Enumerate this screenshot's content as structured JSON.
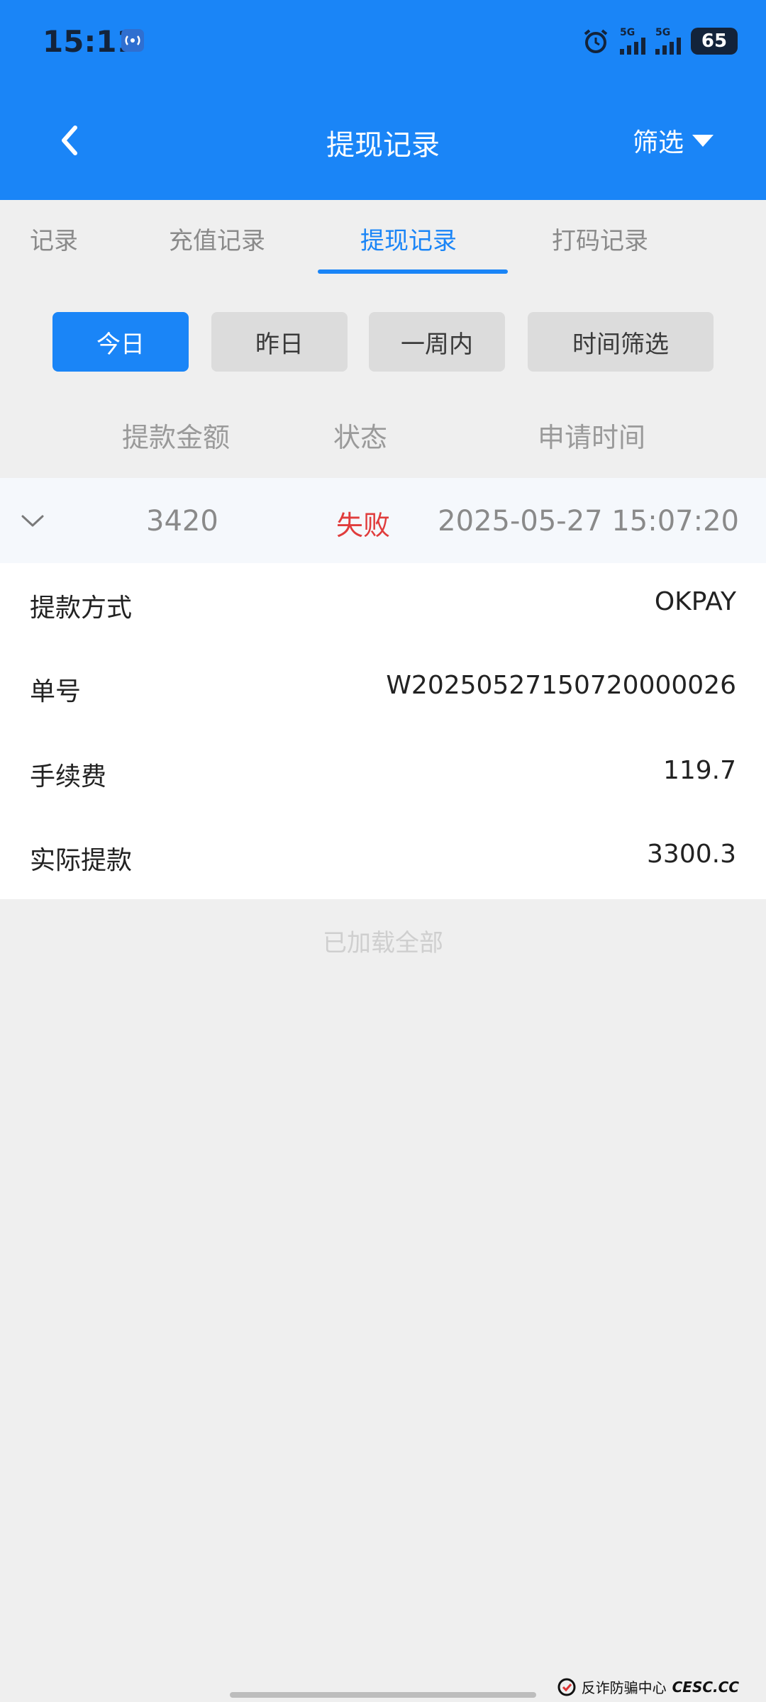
{
  "status_bar": {
    "time": "15:11",
    "sig1_label": "5G",
    "sig2_label": "5G",
    "battery": "65"
  },
  "nav": {
    "title": "提现记录",
    "filter_label": "筛选"
  },
  "tabs": [
    {
      "label": "记录"
    },
    {
      "label": "充值记录"
    },
    {
      "label": "提现记录"
    },
    {
      "label": "打码记录"
    }
  ],
  "active_tab": 2,
  "date_filters": [
    {
      "label": "今日"
    },
    {
      "label": "昨日"
    },
    {
      "label": "一周内"
    },
    {
      "label": "时间筛选"
    }
  ],
  "active_filter": 0,
  "columns": {
    "amount": "提款金额",
    "status": "状态",
    "time": "申请时间"
  },
  "record": {
    "amount": "3420",
    "status": "失败",
    "time": "2025-05-27 15:07:20",
    "status_color": "#e03c3c",
    "details": [
      {
        "label": "提款方式",
        "value": "OKPAY"
      },
      {
        "label": "单号",
        "value": "W20250527150720000026"
      },
      {
        "label": "手续费",
        "value": "119.7"
      },
      {
        "label": "实际提款",
        "value": "3300.3"
      }
    ]
  },
  "footer": {
    "loaded_all": "已加载全部"
  },
  "watermark": {
    "text": "反诈防骗中心",
    "site": "CESC.CC"
  },
  "colors": {
    "primary": "#1a85f7",
    "background": "#efefef",
    "fail": "#e03c3c"
  }
}
